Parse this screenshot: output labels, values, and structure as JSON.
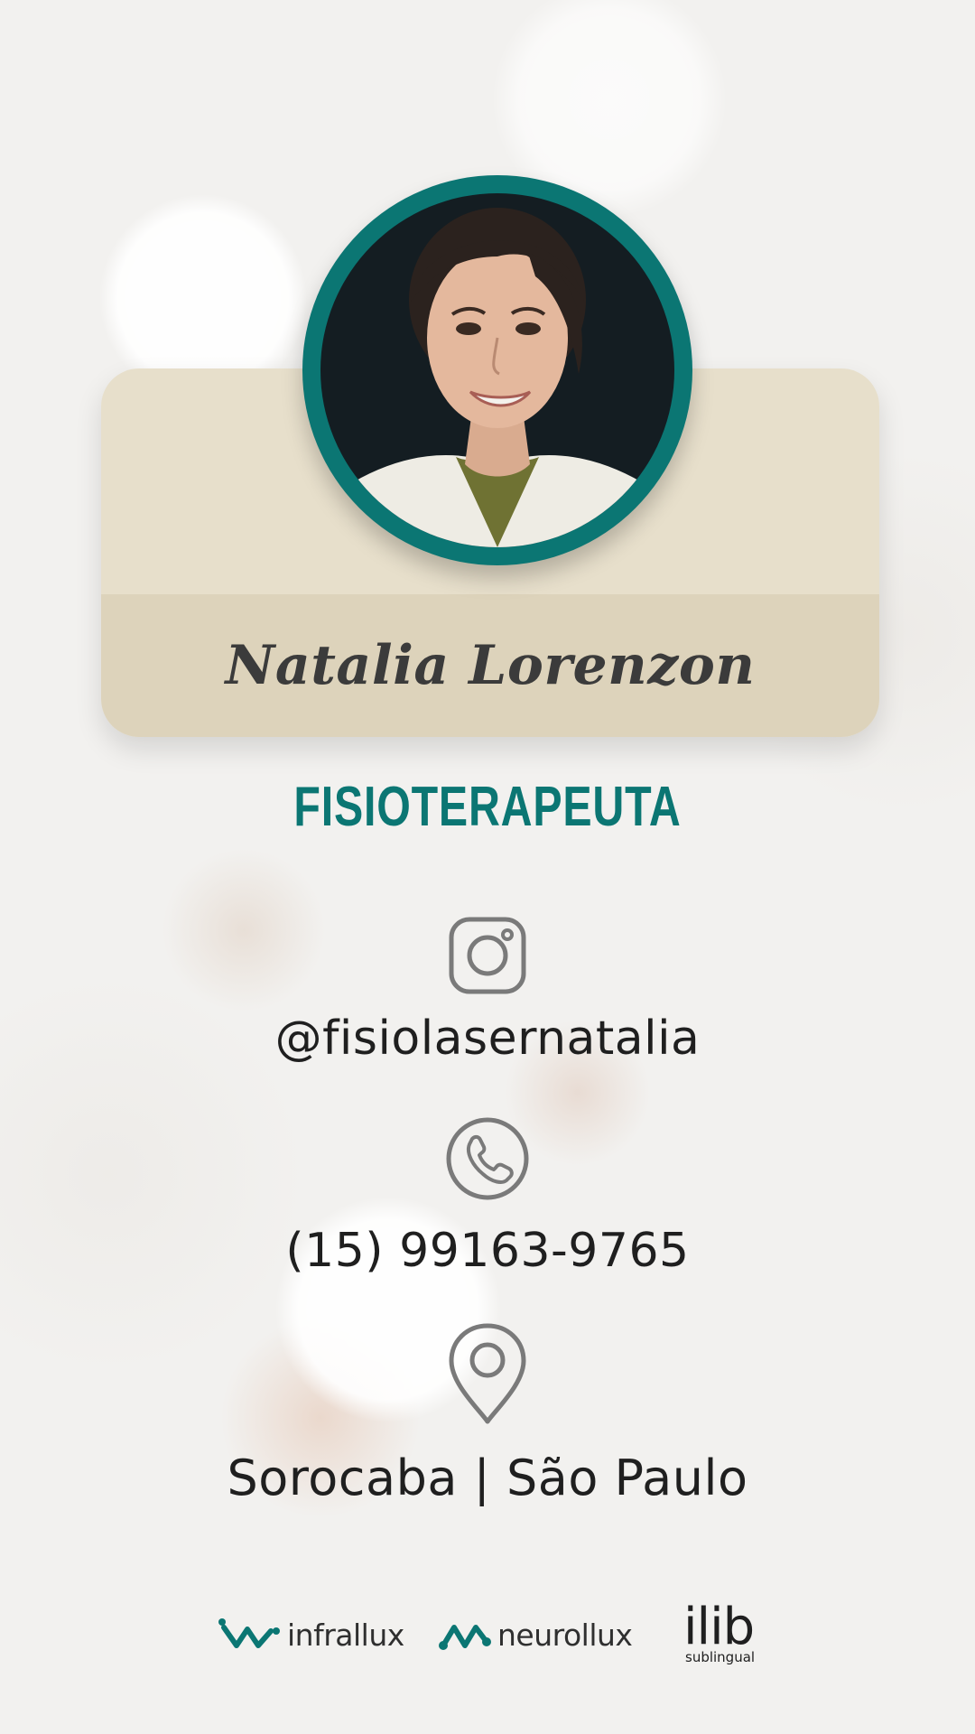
{
  "profile": {
    "name": "Natalia Lorenzon",
    "profession": "FISIOTERAPEUTA"
  },
  "contacts": {
    "instagram": {
      "icon": "instagram-icon",
      "handle": "@fisiolasernatalia"
    },
    "phone": {
      "icon": "phone-icon",
      "number": "(15) 99163-9765"
    },
    "location": {
      "icon": "map-pin-icon",
      "place": "Sorocaba | São Paulo"
    }
  },
  "logos": {
    "infrallux": "infrallux",
    "neurollux": "neurollux",
    "ilib": {
      "main": "ilib",
      "sub": "sublingual"
    }
  },
  "colors": {
    "accent": "#0b7673",
    "card_top": "#e7dfcb",
    "card_bottom": "#ddd3bb",
    "text": "#1f1f1f",
    "icon_stroke": "#7a7a7a"
  }
}
